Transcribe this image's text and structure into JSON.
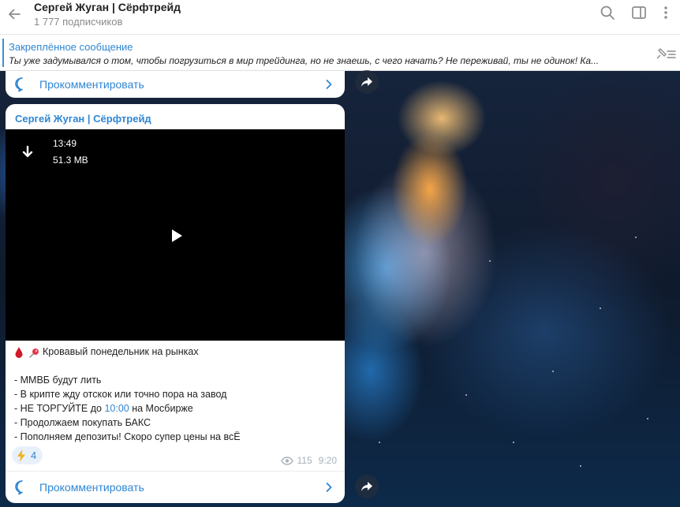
{
  "header": {
    "title": "Сергей Жуган | Сёрфтрейд",
    "subscribers": "1 777 подписчиков"
  },
  "pinned": {
    "label": "Закреплённое сообщение",
    "text": "Ты уже задумывался о том, чтобы погрузиться в мир трейдинга, но не знаешь, с чего начать? Не переживай, ты не одинок! Ка..."
  },
  "comments_label": "Прокомментировать",
  "post": {
    "author": "Сергей Жуган | Сёрфтрейд",
    "video": {
      "duration": "13:49",
      "size": "51.3 MB"
    },
    "headline": "Кровавый понедельник на рынках",
    "lines": {
      "l1": "- ММВБ будут лить",
      "l2": "- В крипте жду отскок или точно пора на завод",
      "l3_pre": "- НЕ ТОРГУЙТЕ до ",
      "l3_time": "10:00",
      "l3_post": " на Мосбирже",
      "l4": "- Продолжаем покупать БАКС",
      "l5": "- Пополняем депозиты! Скоро супер цены на всЁ"
    },
    "reaction": {
      "emoji": "lightning-icon",
      "count": "4"
    },
    "views": "115",
    "time": "9:20"
  },
  "colors": {
    "accent": "#2f86d3",
    "header_bg": "#ffffff",
    "bubble_bg": "#ffffff",
    "reaction_bg": "#e8f1fb"
  }
}
